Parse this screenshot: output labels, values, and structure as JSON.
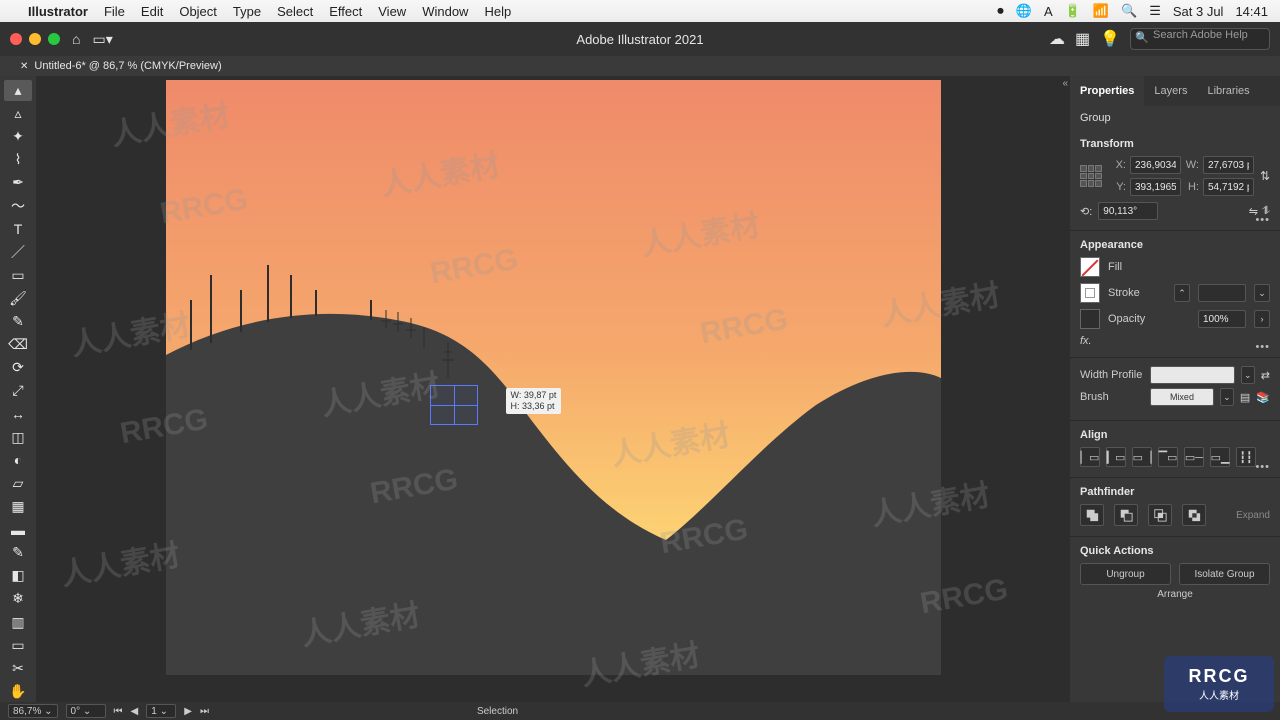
{
  "macos": {
    "app_name": "Illustrator",
    "menus": [
      "File",
      "Edit",
      "Object",
      "Type",
      "Select",
      "Effect",
      "View",
      "Window",
      "Help"
    ],
    "right": {
      "battery": "",
      "date": "Sat 3 Jul",
      "time": "14:41"
    }
  },
  "titlebar": {
    "app_title": "Adobe Illustrator 2021",
    "search_placeholder": "Search Adobe Help"
  },
  "doc_tab": {
    "label": "Untitled-6* @ 86,7 % (CMYK/Preview)"
  },
  "canvas": {
    "dim_w": "W: 39,87 pt",
    "dim_h": "H: 33,36 pt"
  },
  "panel": {
    "tabs": {
      "properties": "Properties",
      "layers": "Layers",
      "libraries": "Libraries"
    },
    "selection_type": "Group",
    "transform_title": "Transform",
    "transform": {
      "x": "236,9034",
      "y": "393,1965",
      "w": "27,6703 p",
      "h": "54,7192 p",
      "rot": "90,113°"
    },
    "labels": {
      "x": "X:",
      "y": "Y:",
      "w": "W:",
      "h": "H:",
      "rot": "⟲:"
    },
    "appearance_title": "Appearance",
    "appearance": {
      "fill": "Fill",
      "stroke": "Stroke",
      "opacity_label": "Opacity",
      "opacity_value": "100%",
      "fx": "fx."
    },
    "width_profile_label": "Width Profile",
    "brush_label": "Brush",
    "brush_value": "Mixed",
    "align_title": "Align",
    "pathfinder_title": "Pathfinder",
    "expand_label": "Expand",
    "quick_actions_title": "Quick Actions",
    "qa": {
      "ungroup": "Ungroup",
      "isolate": "Isolate Group",
      "arrange": "Arrange"
    }
  },
  "status": {
    "zoom": "86,7%",
    "rot": "0°",
    "artboard_nav": "1",
    "tool": "Selection"
  },
  "watermarks": {
    "text": "人人素材",
    "rrcg": "RRCG",
    "rrcg_sub": "人人素材"
  }
}
